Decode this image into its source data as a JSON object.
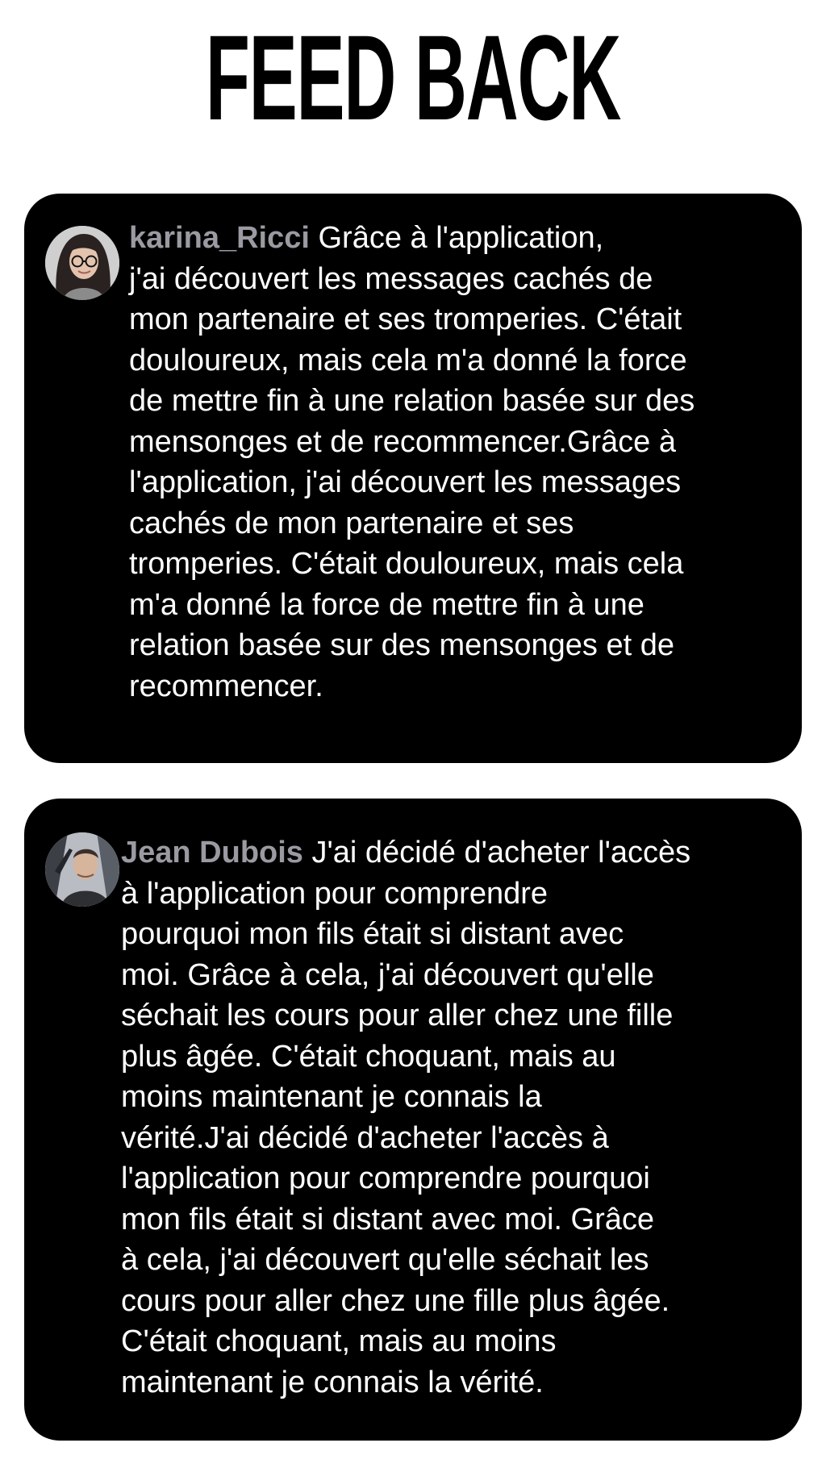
{
  "page": {
    "title": "FEED BACK"
  },
  "reviews": [
    {
      "username": "karina_Ricci",
      "avatar_icon": "woman-with-glasses-avatar",
      "text": "Grâce à l'application,\n j'ai découvert les messages cachés de\nmon partenaire et ses tromperies. C'était\ndouloureux, mais cela m'a donné la force\nde mettre fin à une relation basée sur des\nmensonges et de recommencer.Grâce à\nl'application, j'ai découvert les messages\ncachés de mon partenaire et ses\ntromperies. C'était douloureux, mais cela\nm'a donné la force de mettre fin à une\nrelation basée sur des mensonges et de\nrecommencer."
    },
    {
      "username": "Jean Dubois",
      "avatar_icon": "man-in-car-avatar",
      "text": "J'ai décidé d'acheter l'accès\n à l'application pour comprendre\npourquoi mon fils était si distant avec\nmoi. Grâce à cela, j'ai découvert qu'elle\nséchait les cours pour aller chez une fille\nplus âgée. C'était choquant, mais au\nmoins maintenant je connais la\nvérité.J'ai décidé d'acheter l'accès à\nl'application pour comprendre pourquoi\nmon fils était si distant avec moi. Grâce\nà cela, j'ai découvert qu'elle séchait les\ncours pour aller chez une fille plus âgée.\nC'était choquant, mais au moins\nmaintenant je connais la vérité."
    }
  ],
  "colors": {
    "page_background": "#ffffff",
    "card_background": "#000000",
    "body_text": "#ffffff",
    "username_text": "#9a9aa2"
  }
}
